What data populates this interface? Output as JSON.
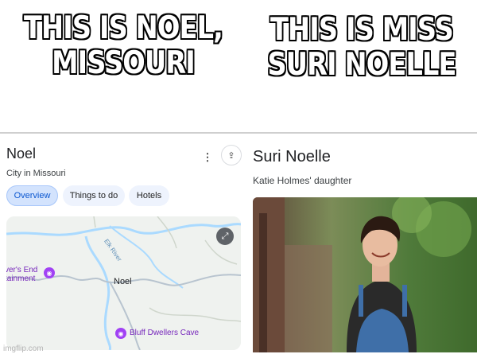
{
  "captions": {
    "left": "THIS IS NOEL, MISSOURI",
    "right": "THIS IS MISS SURI NOELLE"
  },
  "place_card": {
    "title": "Noel",
    "subtitle": "City in Missouri",
    "more_icon": "more-vert-icon",
    "share_icon": "share-icon",
    "chips": [
      {
        "label": "Overview",
        "selected": true
      },
      {
        "label": "Things to do",
        "selected": false
      },
      {
        "label": "Hotels",
        "selected": false
      }
    ],
    "map": {
      "center_label": "Noel",
      "poi_left": "ver's End\ntainment",
      "poi_bottom": "Bluff Dwellers Cave",
      "river_label": "Elk River",
      "expand_icon": "expand-icon",
      "poi_icon": "camera-icon",
      "colors": {
        "land": "#eff2ef",
        "water": "#aadaff",
        "road": "#9aa0a6",
        "poi": "#a142f4"
      }
    }
  },
  "person_card": {
    "title": "Suri Noelle",
    "subtitle": "Katie Holmes' daughter"
  },
  "watermark": "imgflip.com",
  "colors": {
    "chip_selected_bg": "#d3e3fd",
    "chip_selected_text": "#0b57d0",
    "chip_bg": "#eef3fd"
  }
}
